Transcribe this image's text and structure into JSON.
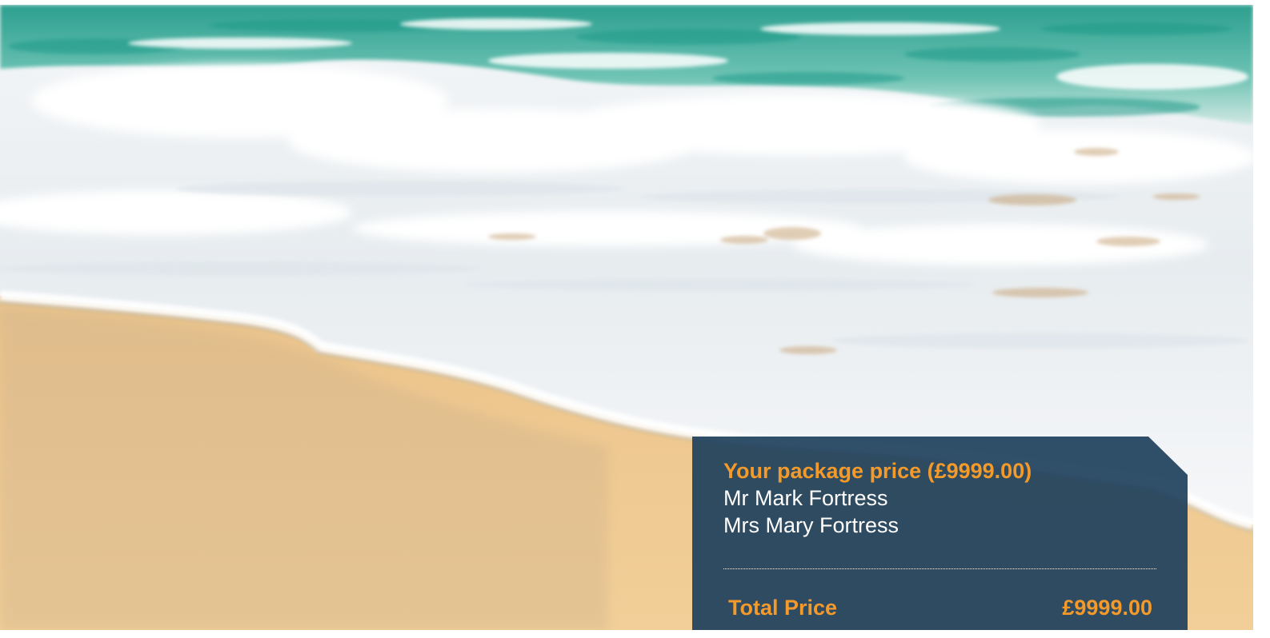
{
  "background": {
    "image": "beach-waves-photo",
    "colors": {
      "sea": "#3fae9e",
      "foam": "#f3f6f8",
      "wet_sand": "#c9b08a",
      "dry_sand": "#efc88d"
    }
  },
  "package": {
    "title": "Your package price (£9999.00)",
    "travellers": [
      "Mr Mark Fortress",
      "Mrs Mary Fortress"
    ],
    "total_label": "Total Price",
    "total_value": "£9999.00",
    "colors": {
      "panel": "#1e405c",
      "accent": "#f39a2b",
      "text": "#ffffff"
    }
  }
}
